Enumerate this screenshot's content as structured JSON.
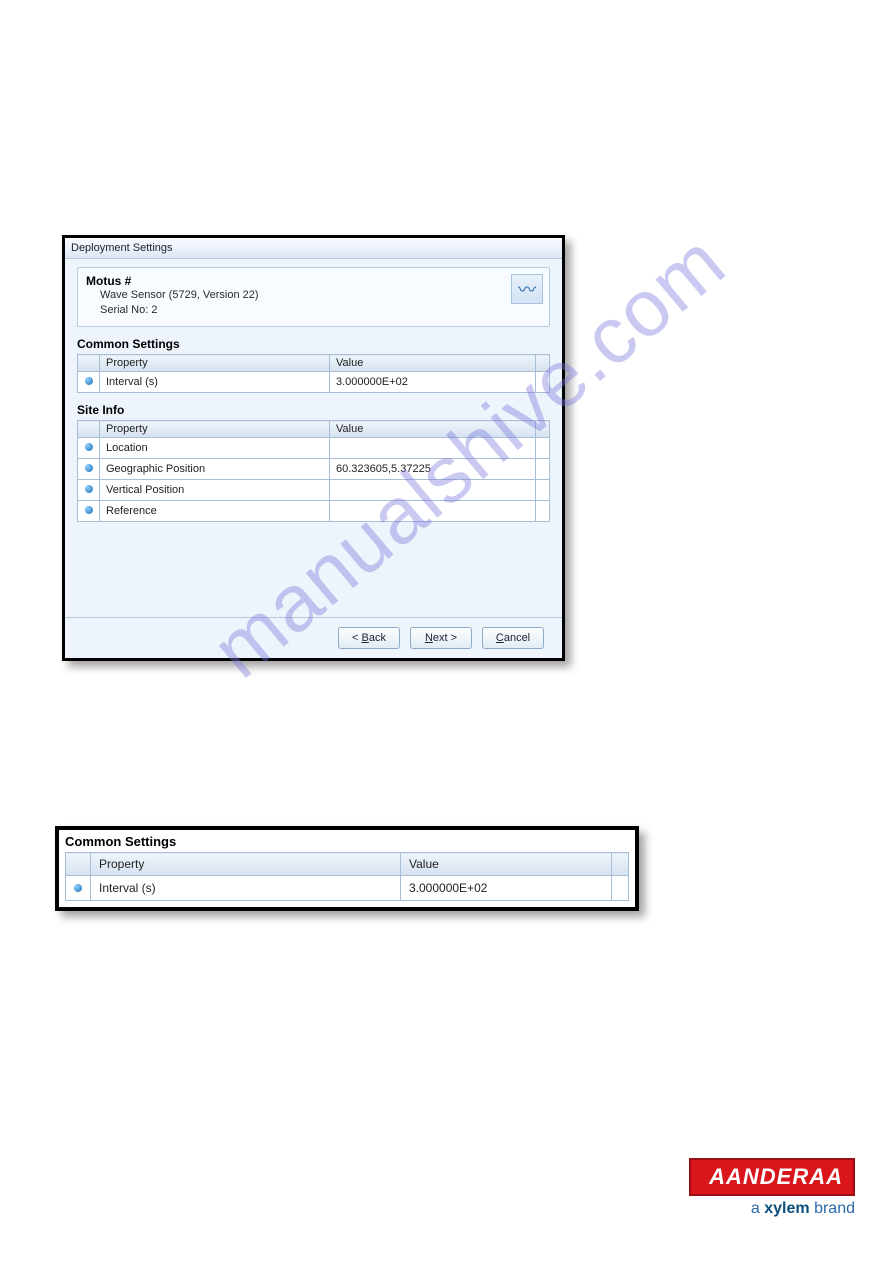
{
  "watermark": "manualshive.com",
  "dialog1": {
    "title": "Deployment Settings",
    "device": {
      "name": "Motus #",
      "sub1": "Wave Sensor (5729, Version 22)",
      "sub2": "Serial No: 2"
    },
    "common": {
      "heading": "Common Settings",
      "col_prop": "Property",
      "col_val": "Value",
      "rows": [
        {
          "prop": "Interval (s)",
          "val": "3.000000E+02"
        }
      ]
    },
    "siteinfo": {
      "heading": "Site Info",
      "col_prop": "Property",
      "col_val": "Value",
      "rows": [
        {
          "prop": "Location",
          "val": ""
        },
        {
          "prop": "Geographic Position",
          "val": "60.323605,5.37225"
        },
        {
          "prop": "Vertical Position",
          "val": ""
        },
        {
          "prop": "Reference",
          "val": ""
        }
      ]
    },
    "buttons": {
      "back_prefix": "< ",
      "back_u": "B",
      "back_rest": "ack",
      "next_u": "N",
      "next_rest": "ext >",
      "cancel_u": "C",
      "cancel_rest": "ancel"
    }
  },
  "dialog2": {
    "heading": "Common Settings",
    "col_prop": "Property",
    "col_val": "Value",
    "row": {
      "prop": "Interval (s)",
      "val": "3.000000E+02"
    }
  },
  "brand": {
    "name": "AANDERAA",
    "tag_a": "a ",
    "tag_b": "xylem",
    "tag_c": " brand"
  }
}
